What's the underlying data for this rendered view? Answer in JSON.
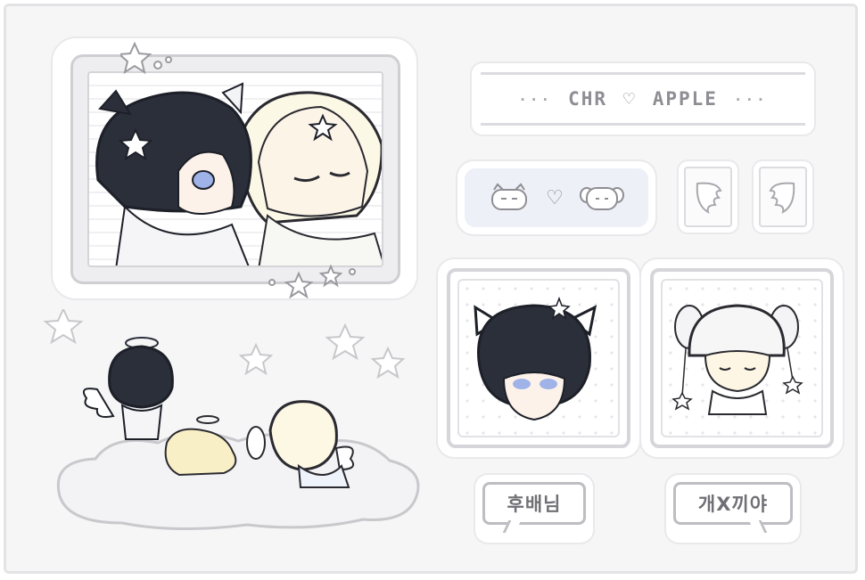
{
  "title_banner": {
    "left_dots": "···",
    "name_left": "CHR",
    "heart": "♡",
    "name_right": "APPLE",
    "right_dots": "···"
  },
  "face_pill": {
    "heart": "♡"
  },
  "bubbles": {
    "left": "후배님",
    "right": "개X끼야"
  },
  "colors": {
    "sheet": "#f6f6f7",
    "outline": "#d6d6da",
    "dark_hair": "#2b2f3a",
    "light_hair": "#fbf8e8",
    "pill": "#eef0f8",
    "text": "#8e8e94"
  },
  "icons": [
    "star-icon",
    "heart-icon",
    "wing-icon",
    "halo-icon",
    "cloud-icon",
    "cat-face-icon",
    "puppy-face-icon"
  ]
}
